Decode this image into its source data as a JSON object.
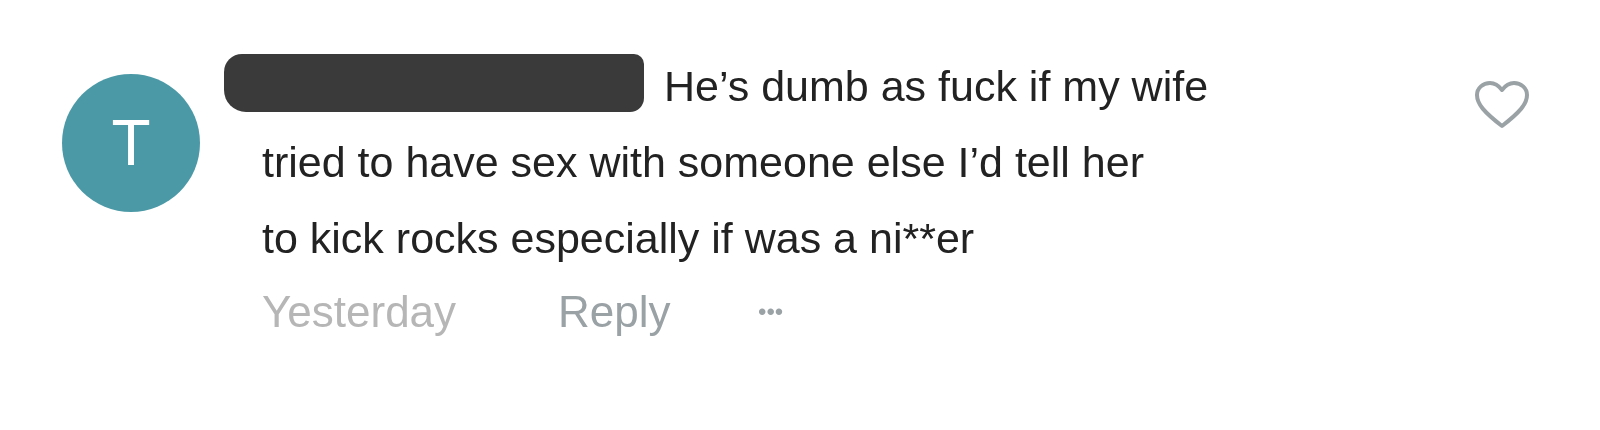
{
  "comment": {
    "avatar_letter": "T",
    "author_redacted": true,
    "text": "He’s dumb as fuck if my wife\ntried to have sex with someone else I’d tell her\nto kick rocks especially if was a ni**er",
    "liked": false,
    "time": "Yesterday",
    "reply": "Reply",
    "more": "•••"
  }
}
